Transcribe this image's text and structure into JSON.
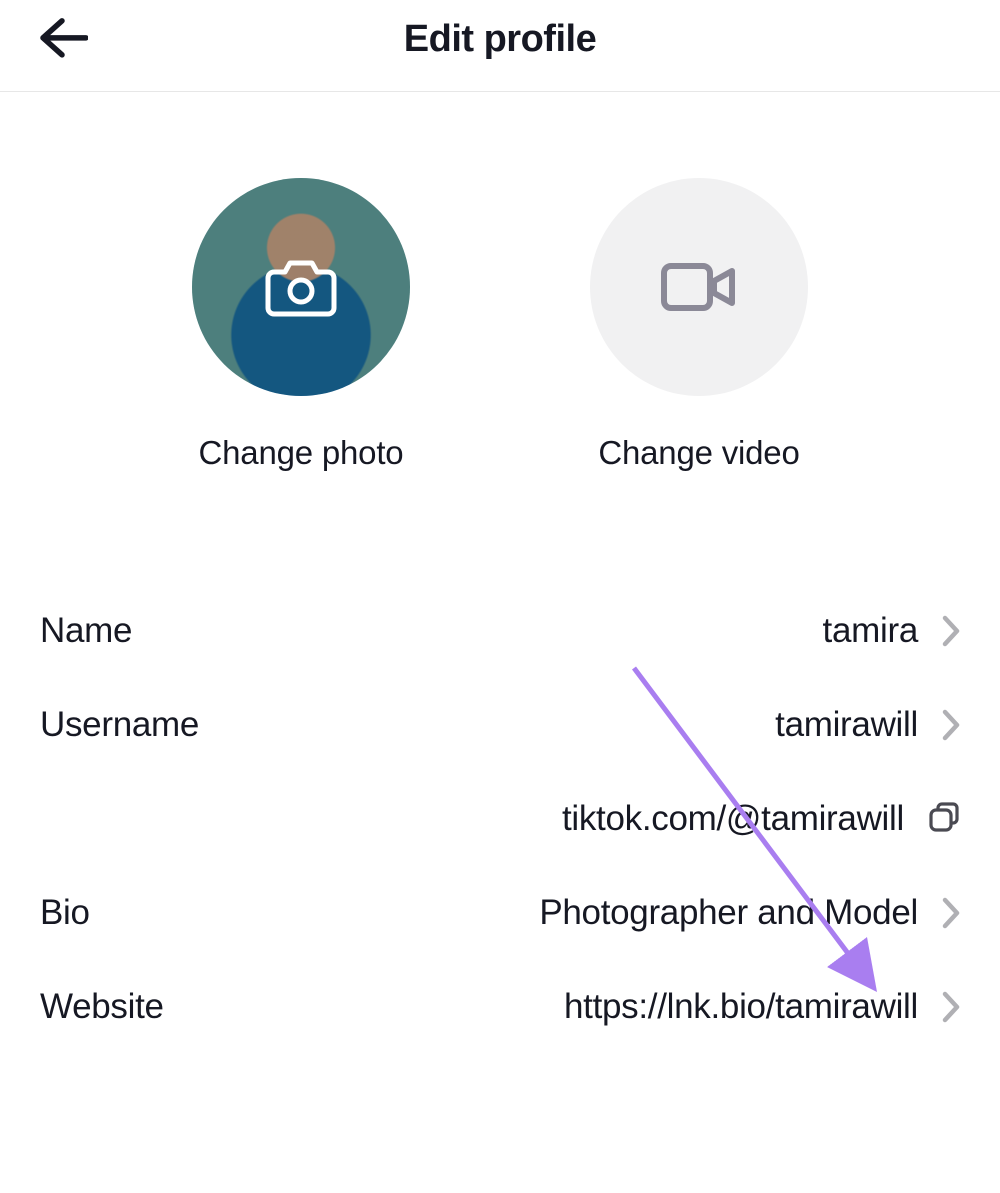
{
  "header": {
    "title": "Edit profile"
  },
  "media": {
    "photo_label": "Change photo",
    "video_label": "Change video"
  },
  "fields": {
    "name": {
      "label": "Name",
      "value": "tamira"
    },
    "username": {
      "label": "Username",
      "value": "tamirawill"
    },
    "profile_url": "tiktok.com/@tamirawill",
    "bio": {
      "label": "Bio",
      "value": "Photographer and Model"
    },
    "website": {
      "label": "Website",
      "value": "https://lnk.bio/tamirawill"
    }
  },
  "annotation": {
    "arrow_color": "#a97ef0"
  }
}
